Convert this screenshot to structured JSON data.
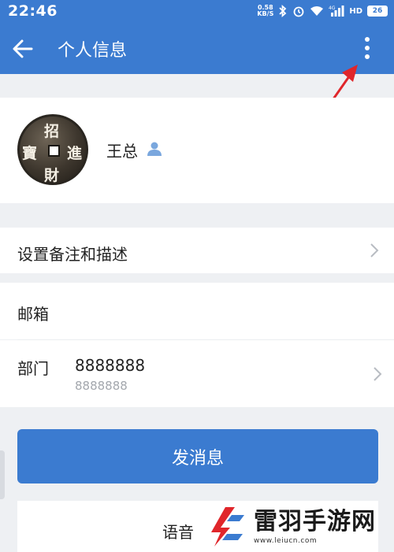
{
  "status_bar": {
    "time": "22:46",
    "net_speed_value": "0.58",
    "net_speed_unit": "KB/S",
    "hd_label": "HD",
    "battery": "26",
    "signal_label": "4G"
  },
  "app_bar": {
    "title": "个人信息"
  },
  "profile": {
    "name": "王总",
    "avatar_chars": [
      "招",
      "進",
      "財",
      "寶"
    ]
  },
  "rows": {
    "remark": {
      "label": "设置备注和描述"
    },
    "email": {
      "label": "邮箱",
      "value": ""
    },
    "department": {
      "label": "部门",
      "value": "8888888",
      "sub_value": "8888888"
    }
  },
  "send_button": {
    "label": "发消息"
  },
  "voice": {
    "label": "语音"
  },
  "watermark": {
    "title": "雷羽手游网",
    "url": "www.leiucn.com"
  },
  "colors": {
    "primary": "#3b7bd0",
    "background": "#eef0f3",
    "arrow": "#e0262b"
  }
}
